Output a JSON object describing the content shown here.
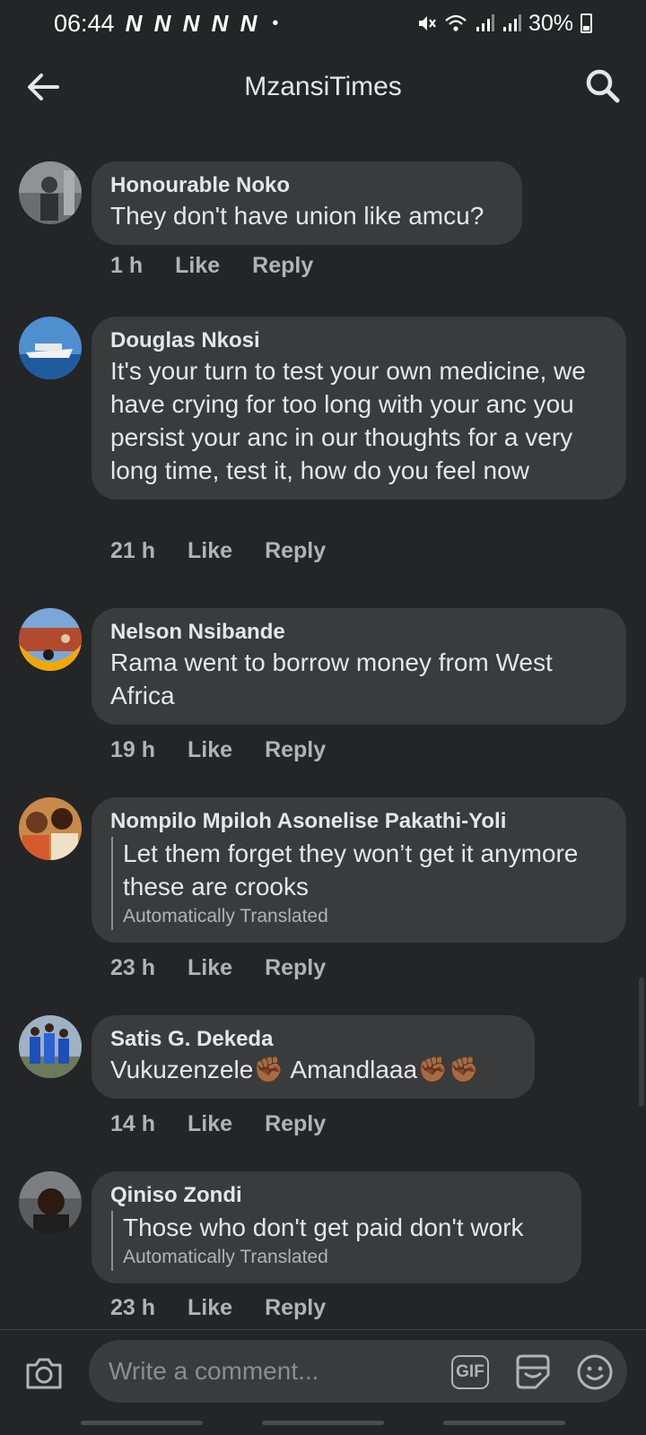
{
  "status_bar": {
    "time": "06:44",
    "notifications": "N N N N N",
    "dot": "•",
    "battery": "30%"
  },
  "header": {
    "title": "MzansiTimes"
  },
  "comments": [
    {
      "author": "Honourable Noko",
      "text": "They don't have union like amcu?",
      "time": "1 h",
      "like": "Like",
      "reply": "Reply"
    },
    {
      "author": "Douglas Nkosi",
      "text": "It's your turn to test your own medicine, we have crying for too long with your anc you persist your anc in our thoughts for a very long time, test it, how do you feel now",
      "time": "21 h",
      "like": "Like",
      "reply": "Reply"
    },
    {
      "author": "Nelson Nsibande",
      "text": "Rama went to borrow money from West Africa",
      "time": "19 h",
      "like": "Like",
      "reply": "Reply"
    },
    {
      "author": "Nompilo Mpiloh Asonelise Pakathi-Yoli",
      "text": "Let them forget they won’t get it anymore these are crooks",
      "translated_note": "Automatically Translated",
      "time": "23 h",
      "like": "Like",
      "reply": "Reply"
    },
    {
      "author": "Satis G. Dekeda",
      "text": "Vukuzenzele✊🏾 Amandlaaa✊🏾✊🏾",
      "time": "14 h",
      "like": "Like",
      "reply": "Reply"
    },
    {
      "author": "Qiniso Zondi",
      "text": "Those who don't get paid don't work",
      "translated_note": "Automatically Translated",
      "time": "23 h",
      "like": "Like",
      "reply": "Reply"
    }
  ],
  "composer": {
    "placeholder": "Write a comment...",
    "gif_label": "GIF"
  },
  "colors": {
    "background": "#242526",
    "bubble": "#3a3b3c",
    "primary_text": "#e4e6eb",
    "secondary_text": "#b0b3b8"
  },
  "icons": [
    "back-arrow-icon",
    "search-icon",
    "camera-icon",
    "gif-icon",
    "sticker-icon",
    "emoji-icon",
    "mute-icon",
    "wifi-icon",
    "signal-icon",
    "battery-icon"
  ]
}
